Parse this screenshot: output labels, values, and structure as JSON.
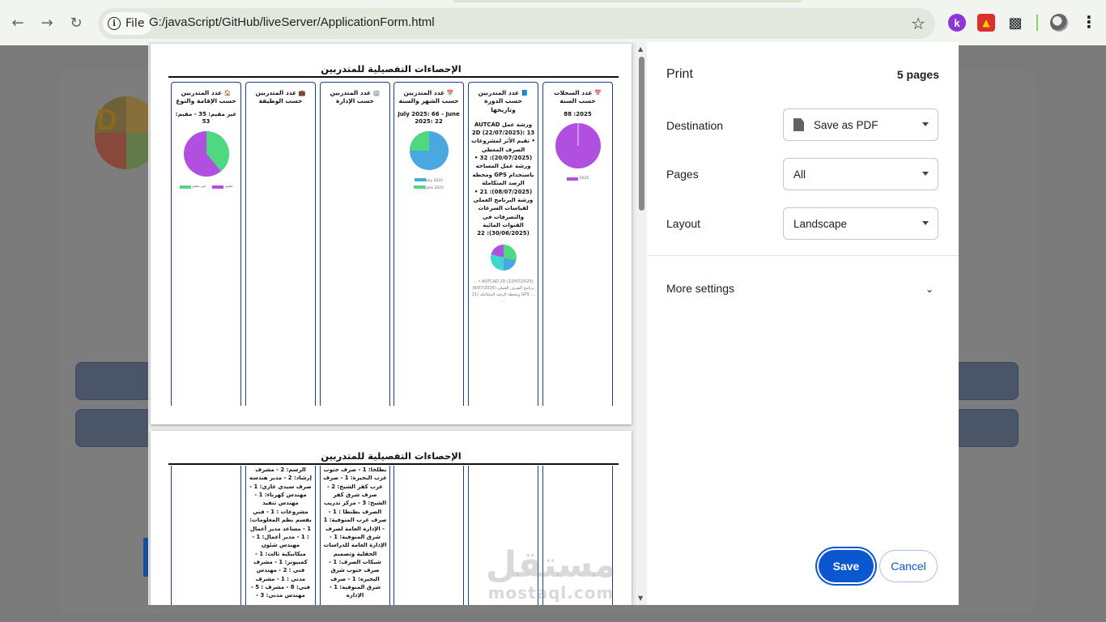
{
  "browser": {
    "site_chip": "File",
    "url": "G:/javaScript/GitHub/liveServer/ApplicationForm.html",
    "ext_k_label": "k"
  },
  "page_title": "الإحصاءات التفصيلية للمتدربين",
  "columns": [
    {
      "icon": "📅",
      "heading": "عدد السجلات حسب السنة",
      "stat": "2025: 88",
      "legend": [
        "2025"
      ]
    },
    {
      "icon": "📘",
      "heading": "عدد المتدربين حسب الدورة وتاريخها",
      "body": "ورشة عمل AUTCAD 2D (22/07/2025): 13 • تقيم الأثر لمشروعات الصرف المغطي (20/07/2025): 32 • ورشة عمل المساحة باستخدام GPS ومحطة الرصد المتكاملة (08/07/2025): 21 • ورشة البرنامج العملي لقياسات السرعات والتصرفات في القنوات المائية (30/06/2025): 22",
      "legend_faded": "AUTCAD 2D (22/07/2025) • ... برنامج الصرف العملي (6/07/2025) ... GPS ومحطة الرصد المتكاملة (21 ..."
    },
    {
      "icon": "📅",
      "heading": "عدد المتدربين حسب الشهر والسنة",
      "stat": "July 2025: 66 - June 2025: 22",
      "legend": [
        "July 2025",
        "June 2025"
      ]
    },
    {
      "icon": "🏢",
      "heading": "عدد المتدربين حسب الإدارة"
    },
    {
      "icon": "💼",
      "heading": "عدد المتدربين حسب الوظيفة"
    },
    {
      "icon": "🏠",
      "heading": "عدد المتدربين حسب الإقامة والنوع",
      "stat": "غير مقيم: 35 - مقيم: 53",
      "legend": [
        "غير مقيم",
        "مقيم"
      ]
    }
  ],
  "page2": {
    "title": "الإحصاءات التفصيلية للمتدربين",
    "col_admin_text": "بطلخا: 1 - صرف جنوب غرب البحيرة: 1 - صرف غرب كفر الشيخ: 2 - صرف شرق كفر الشيخ: 3 - مركز تدريب الصرف بطنطا : 1 - صرف غرب المنوفية: 1 - الإدارة العامة لصرف شرق المنوفية: 1 - الإدارة العامة للدراسات الحقلية وتصميم شبكات الصرف: 1 - صرف جنوب شرق البحيرة: 1 - صرف شرق المنوفية: 1 - الإدارة",
    "col_job_text": "الرسم: 2 - مشرف إرشاد: 2 - مدير هندسة صرف سيدي غازي: 1 - مهندس كهرباء: 1 - مهندس تنفيذ مشروعات : 1 - فني بقسم نظم المعلومات: 1 - مساعد مدير أعمال : 1 - مدير أعمال: 1 - مهندس شئون ميكانيكية ثالث: 1 - كمبيوتر: 1 - مشرف فني : 2 - مهندس مدني : 1 - مشرف فني: 8 - مشرف : 5 - مهندس مدني: 3 -"
  },
  "print_panel": {
    "title": "Print",
    "page_count": "5 pages",
    "destination_label": "Destination",
    "destination_value": "Save as PDF",
    "pages_label": "Pages",
    "pages_value": "All",
    "layout_label": "Layout",
    "layout_value": "Landscape",
    "more_settings": "More settings",
    "save": "Save",
    "cancel": "Cancel"
  },
  "watermark": {
    "arabic": "مستقل",
    "latin": "mostaql.com"
  },
  "colors": {
    "accent": "#0b57d0",
    "pie_purple": "#b04fe0",
    "pie_blue": "#4aa8e0",
    "pie_green": "#4ed882",
    "pie_cyan": "#3fd6d0",
    "column_border": "#1e3f8a"
  }
}
